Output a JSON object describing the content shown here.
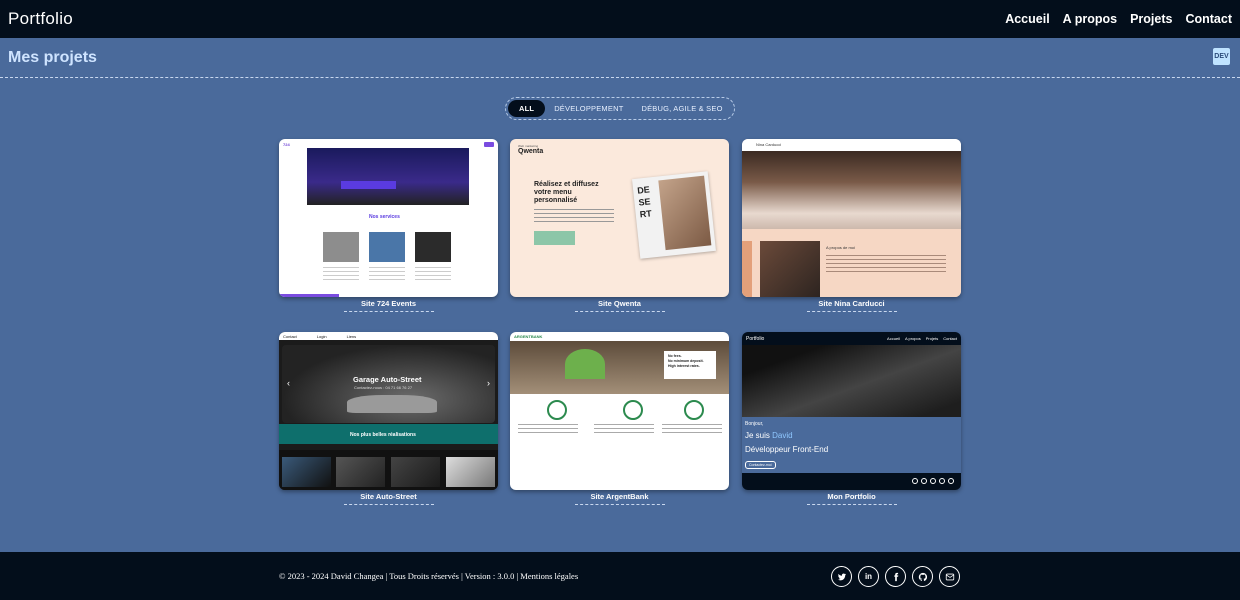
{
  "header": {
    "brand": "Portfolio",
    "nav": [
      "Accueil",
      "A propos",
      "Projets",
      "Contact"
    ]
  },
  "section": {
    "title": "Mes projets",
    "badge": "DEV"
  },
  "filters": [
    "ALL",
    "DÉVELOPPEMENT",
    "DÉBUG, AGILE & SEO"
  ],
  "projects": [
    {
      "caption": "Site 724 Events",
      "thumb": {
        "logo": "724",
        "section": "Nos services"
      }
    },
    {
      "caption": "Site Qwenta",
      "thumb": {
        "logo": "Qwenta",
        "tagline": "Web marketing",
        "headline_1": "Réalisez et diffusez",
        "headline_2": "votre menu",
        "headline_3": "personnalisé",
        "dessert": "DE SE RT"
      }
    },
    {
      "caption": "Site Nina Carducci",
      "thumb": {
        "logo": "Nina Carducci",
        "about": "A propos de moi"
      }
    },
    {
      "caption": "Site Auto-Street",
      "thumb": {
        "nav": [
          "Contact",
          "Login",
          "Liens"
        ],
        "hero_title": "Garage Auto-Street",
        "hero_sub": "Contactez-nous : 04 71 66 76 27",
        "section": "Nos plus belles réalisations"
      }
    },
    {
      "caption": "Site ArgentBank",
      "thumb": {
        "logo": "ARGENTBANK",
        "hero_1": "No fees.",
        "hero_2": "No minimum deposit.",
        "hero_3": "High interest rates."
      }
    },
    {
      "caption": "Mon Portfolio",
      "thumb": {
        "logo": "Portfolio",
        "nav": [
          "Accueil",
          "A propos",
          "Projets",
          "Contact"
        ],
        "hello": "Bonjour,",
        "line_1": "Je suis",
        "name": "David",
        "line_2": "Développeur Front-End",
        "cta": "Contactez-moi"
      }
    }
  ],
  "footer": {
    "copyright": "© 2023 - 2024 David Changea | Tous Droits réservés | Version : 3.0.0 | Mentions légales",
    "socials": [
      "twitter-icon",
      "linkedin-icon",
      "facebook-icon",
      "github-icon",
      "mail-icon"
    ]
  },
  "colors": {
    "background": "#4a6a9b",
    "bar": "#030e1b",
    "accent": "#cfe4ff"
  }
}
